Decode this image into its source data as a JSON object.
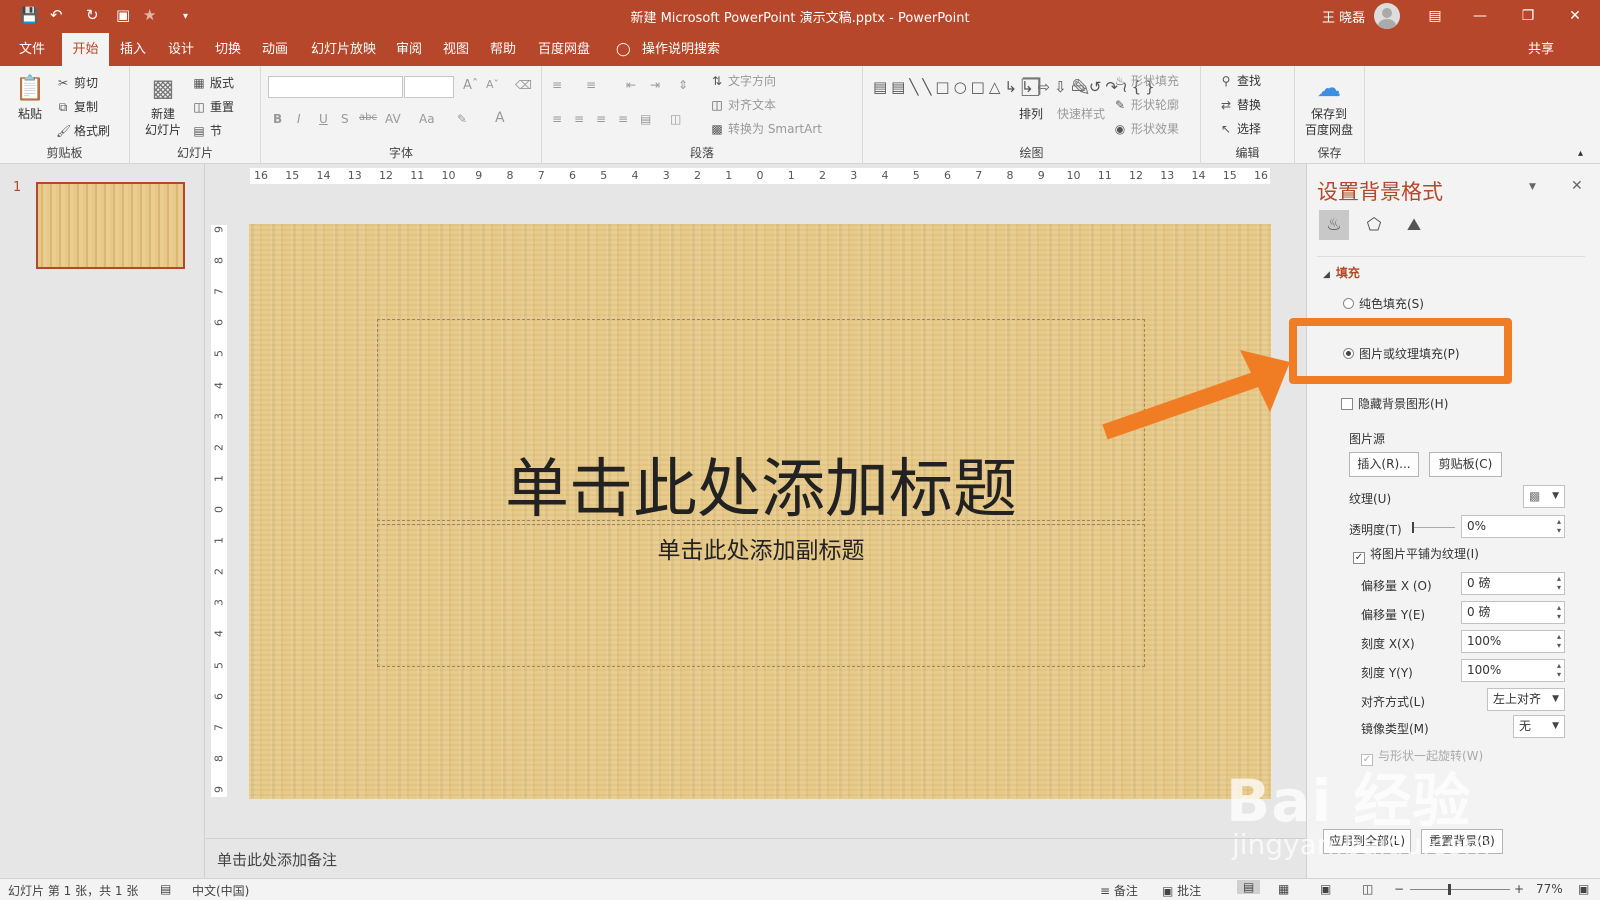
{
  "titlebar": {
    "doc_title": "新建 Microsoft PowerPoint 演示文稿.pptx  -  PowerPoint",
    "user": "王 晓磊"
  },
  "tabs": [
    "文件",
    "开始",
    "插入",
    "设计",
    "切换",
    "动画",
    "幻灯片放映",
    "审阅",
    "视图",
    "帮助",
    "百度网盘"
  ],
  "tell_me": "操作说明搜索",
  "share": "共享",
  "ribbon": {
    "clipboard": {
      "label": "剪贴板",
      "paste": "粘贴",
      "cut": "剪切",
      "copy": "复制",
      "format_painter": "格式刷"
    },
    "slides": {
      "label": "幻灯片",
      "new_slide": "新建\n幻灯片",
      "layout": "版式",
      "reset": "重置",
      "section": "节"
    },
    "font": {
      "label": "字体"
    },
    "paragraph": {
      "label": "段落",
      "text_direction": "文字方向",
      "align_text": "对齐文本",
      "smartart": "转换为 SmartArt"
    },
    "drawing": {
      "label": "绘图",
      "arrange": "排列",
      "quick_styles": "快速样式",
      "shape_fill": "形状填充",
      "shape_outline": "形状轮廓",
      "shape_effects": "形状效果"
    },
    "editing": {
      "label": "编辑",
      "find": "查找",
      "replace": "替换",
      "select": "选择"
    },
    "save": {
      "label": "保存",
      "save_to": "保存到\n百度网盘"
    }
  },
  "rulers": {
    "h_ticks": [
      "16",
      "15",
      "14",
      "13",
      "12",
      "11",
      "10",
      "9",
      "8",
      "7",
      "6",
      "5",
      "4",
      "3",
      "2",
      "1",
      "0",
      "1",
      "2",
      "3",
      "4",
      "5",
      "6",
      "7",
      "8",
      "9",
      "10",
      "11",
      "12",
      "13",
      "14",
      "15",
      "16"
    ],
    "v_ticks": [
      "9",
      "8",
      "7",
      "6",
      "5",
      "4",
      "3",
      "2",
      "1",
      "0",
      "1",
      "2",
      "3",
      "4",
      "5",
      "6",
      "7",
      "8",
      "9"
    ]
  },
  "thumb_number": "1",
  "slide": {
    "title": "单击此处添加标题",
    "subtitle": "单击此处添加副标题"
  },
  "notes": "单击此处添加备注",
  "panel": {
    "title": "设置背景格式",
    "section": "填充",
    "solid": "纯色填充(S)",
    "picture": "图片或纹理填充(P)",
    "hide_bg": "隐藏背景图形(H)",
    "source": "图片源",
    "insert": "插入(R)...",
    "clipboard": "剪贴板(C)",
    "texture": "纹理(U)",
    "transparency": "透明度(T)",
    "transparency_val": "0%",
    "tile": "将图片平铺为纹理(I)",
    "offset_x": "偏移量 X (O)",
    "offset_x_val": "0 磅",
    "offset_y": "偏移量 Y(E)",
    "offset_y_val": "0 磅",
    "scale_x": "刻度 X(X)",
    "scale_x_val": "100%",
    "scale_y": "刻度 Y(Y)",
    "scale_y_val": "100%",
    "align": "对齐方式(L)",
    "align_val": "左上对齐",
    "mirror": "镜像类型(M)",
    "mirror_val": "无",
    "rotate": "与形状一起旋转(W)",
    "apply_all": "应用到全部(L)",
    "reset_bg": "重置背景(B)"
  },
  "status": {
    "slide_info": "幻灯片 第 1 张，共 1 张",
    "lang": "中文(中国)",
    "notes": "备注",
    "comments": "批注",
    "zoom": "77%"
  },
  "watermark": {
    "main": "Bai 经验",
    "sub": "jingyan.baidu.com"
  },
  "colors": {
    "accent": "#b7472a",
    "highlight": "#f07d23"
  }
}
